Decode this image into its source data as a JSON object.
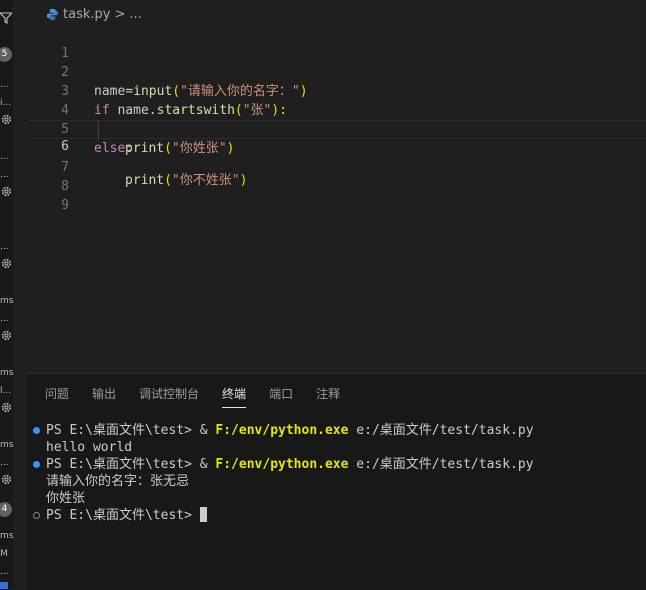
{
  "breadcrumb": {
    "file": "task.py",
    "sep": ">",
    "more": "..."
  },
  "sidebar": {
    "badges": [
      "5",
      "4"
    ],
    "fragments": [
      "...",
      "i...",
      "...",
      "...",
      "...",
      "ms",
      "...",
      "ms",
      "l...",
      "ms",
      "...",
      "ms",
      "M",
      "..."
    ]
  },
  "editor": {
    "line_numbers": [
      "1",
      "2",
      "3",
      "4",
      "5",
      "6",
      "7",
      "8",
      "9"
    ],
    "active_line": "6",
    "lines": {
      "l2": {
        "a": "name",
        "b": "=",
        "c": "input",
        "d": "(",
        "e": "\"请输入你的名字：\"",
        "f": ")"
      },
      "l3": {
        "a": "if",
        "b": " name.",
        "c": "startswith",
        "d": "(",
        "e": "\"张\"",
        "f": "):"
      },
      "l4": {
        "a": "print",
        "b": "(",
        "c": "\"你姓张\"",
        "d": ")"
      },
      "l5": {
        "a": "else",
        "b": ":"
      },
      "l6": {
        "a": "print",
        "b": "(",
        "c": "\"你不姓张\"",
        "d": ")"
      }
    }
  },
  "panel": {
    "tabs": [
      "问题",
      "输出",
      "调试控制台",
      "终端",
      "端口",
      "注释"
    ],
    "active_tab": "终端"
  },
  "terminal": {
    "prompt": "PS E:\\桌面文件\\test>",
    "amp": "&",
    "exe": "F:/env/python.exe",
    "script": "e:/桌面文件/test/task.py",
    "out1": "hello world",
    "out2": "请输入你的名字：张无忌",
    "out3": "你姓张"
  },
  "colors": {
    "accent": "#3794ff",
    "string": "#ce9178",
    "function": "#dcdcaa",
    "keyword": "#c586c0",
    "bracket": "#ffd700"
  }
}
